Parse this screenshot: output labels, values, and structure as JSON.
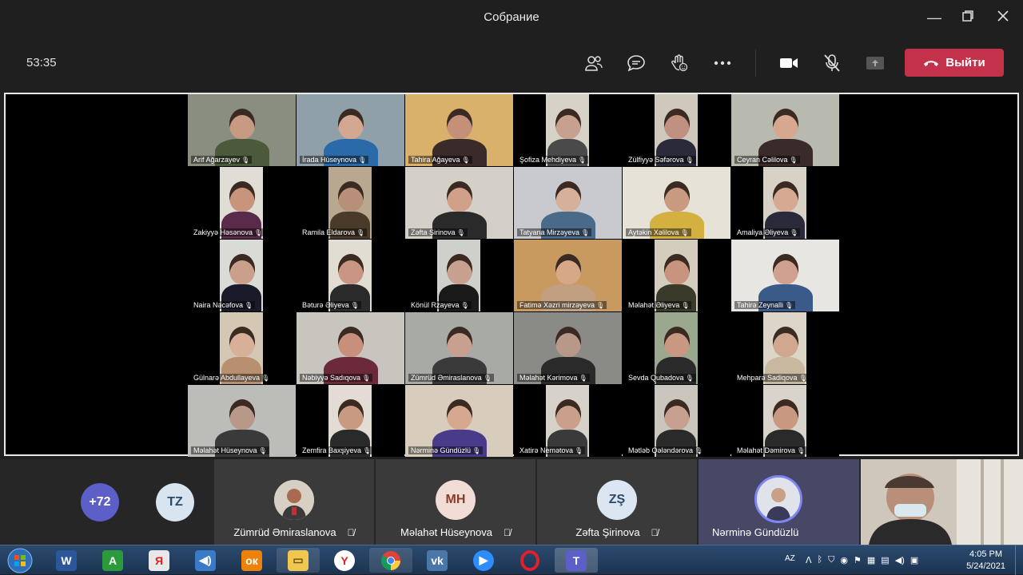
{
  "window": {
    "title": "Собрание"
  },
  "toolbar": {
    "timer": "53:35",
    "leave_label": "Выйти"
  },
  "grid": [
    {
      "name": "Arif Ağarzayev",
      "bg": "#8a8e80",
      "skin": "#c79a82",
      "shirt": "#4a5a3a"
    },
    {
      "name": "İrada Hüseynova",
      "bg": "#8fa0a8",
      "skin": "#d2a893",
      "shirt": "#2a6aa8"
    },
    {
      "name": "Tahira Ağayeva",
      "bg": "#d9b16a",
      "skin": "#c49077",
      "shirt": "#3a2a2a"
    },
    {
      "name": "Şofiza Mehdiyeva",
      "bg": "#d6d2c8",
      "skin": "#c8a090",
      "shirt": "#4a4a4a"
    },
    {
      "name": "Zülfiyyə Səfərova",
      "bg": "#cfc8bc",
      "skin": "#c09080",
      "shirt": "#2a2a3a"
    },
    {
      "name": "Ceyran Cəlilova",
      "bg": "#b8bab0",
      "skin": "#d6a890",
      "shirt": "#3a2a2a"
    },
    {
      "name": "Zakiyyə Həsənova",
      "bg": "#e0dcd6",
      "skin": "#c8957c",
      "shirt": "#5a2a4a"
    },
    {
      "name": "Ramila Eldarova",
      "bg": "#b8a890",
      "skin": "#b8907a",
      "shirt": "#4a3a2a"
    },
    {
      "name": "Zəfta Şirinova",
      "bg": "#d4d0c8",
      "skin": "#d0a088",
      "shirt": "#2a2a2a"
    },
    {
      "name": "Tatyana Mirzəyeva",
      "bg": "#c8cad0",
      "skin": "#d6b09a",
      "shirt": "#4a6a8a"
    },
    {
      "name": "Aytəkin Xəlilova",
      "bg": "#e6e2d8",
      "skin": "#c89a80",
      "shirt": "#d4b040"
    },
    {
      "name": "Amaliya Əliyeva",
      "bg": "#d8d2c6",
      "skin": "#d6aa92",
      "shirt": "#2a2a3a"
    },
    {
      "name": "Naira Nəcəfova",
      "bg": "#dadad6",
      "skin": "#caa08a",
      "shirt": "#1a1a2a"
    },
    {
      "name": "Bəturə Əliyeva",
      "bg": "#e2ddd2",
      "skin": "#c89682",
      "shirt": "#2a2a2a"
    },
    {
      "name": "Könül Rzayeva",
      "bg": "#cfcfcb",
      "skin": "#c8a090",
      "shirt": "#1a1a1a"
    },
    {
      "name": "Fatimə Xəzri mirzəyeva",
      "bg": "#c89a60",
      "skin": "#d6a888",
      "shirt": "#c0a080"
    },
    {
      "name": "Məlahət Əliyeva",
      "bg": "#d4ccbc",
      "skin": "#c89480",
      "shirt": "#3a3a2a"
    },
    {
      "name": "Tahirə Zeynalli",
      "bg": "#e8e6e2",
      "skin": "#d0a090",
      "shirt": "#3a5a8a"
    },
    {
      "name": "Gülnarə Abdullayeva",
      "bg": "#d4c8b4",
      "skin": "#d8b098",
      "shirt": "#b89070"
    },
    {
      "name": "Nəbiyyə Sadıqova",
      "bg": "#c8c4be",
      "skin": "#c8907c",
      "shirt": "#6a2a3a"
    },
    {
      "name": "Zümrüd Əmiraslanova",
      "bg": "#a8aaa6",
      "skin": "#c8a090",
      "shirt": "#3a3a3a"
    },
    {
      "name": "Məlahət Kərimova",
      "bg": "#8a8a86",
      "skin": "#b89888",
      "shirt": "#2a2a2a"
    },
    {
      "name": "Sevda Qubadova",
      "bg": "#9aa890",
      "skin": "#c89880",
      "shirt": "#2a2a2a"
    },
    {
      "name": "Mehparə Sadiqova",
      "bg": "#dcd6c8",
      "skin": "#d0a890",
      "shirt": "#c8b8a0"
    },
    {
      "name": "Məlahət Hüseynova",
      "bg": "#bcbcb8",
      "skin": "#b89888",
      "shirt": "#3a3a3a"
    },
    {
      "name": "Zemfira Baxşiyeva",
      "bg": "#e2dcd4",
      "skin": "#c89a82",
      "shirt": "#2a2a2a"
    },
    {
      "name": "Nərminə Gündüzlü",
      "bg": "#d8ccbc",
      "skin": "#d6a890",
      "shirt": "#4a3a8a"
    },
    {
      "name": "Xatirə Nemətova",
      "bg": "#d6d2ca",
      "skin": "#c8a08c",
      "shirt": "#3a3a3a"
    },
    {
      "name": "Mətləb Qələndərova",
      "bg": "#cac6be",
      "skin": "#c8a090",
      "shirt": "#2a2a2a"
    },
    {
      "name": "Məlahət Dəmirova",
      "bg": "#d8d4cc",
      "skin": "#c89880",
      "shirt": "#2a2a2a"
    }
  ],
  "roster": {
    "more_count": "+72",
    "tz_initials": "TZ",
    "tiles": [
      {
        "name": "Zümrüd Əmiraslanova",
        "initials": ""
      },
      {
        "name": "Məlahət Hüseynova",
        "initials": "MH"
      },
      {
        "name": "Zəfta Şirinova",
        "initials": "ZŞ"
      },
      {
        "name": "Nərminə Gündüzlü",
        "initials": ""
      }
    ]
  },
  "taskbar": {
    "lang": "AZ",
    "time": "4:05 PM",
    "date": "5/24/2021"
  },
  "colors": {
    "leave": "#c4314b",
    "accent": "#6264a7"
  }
}
